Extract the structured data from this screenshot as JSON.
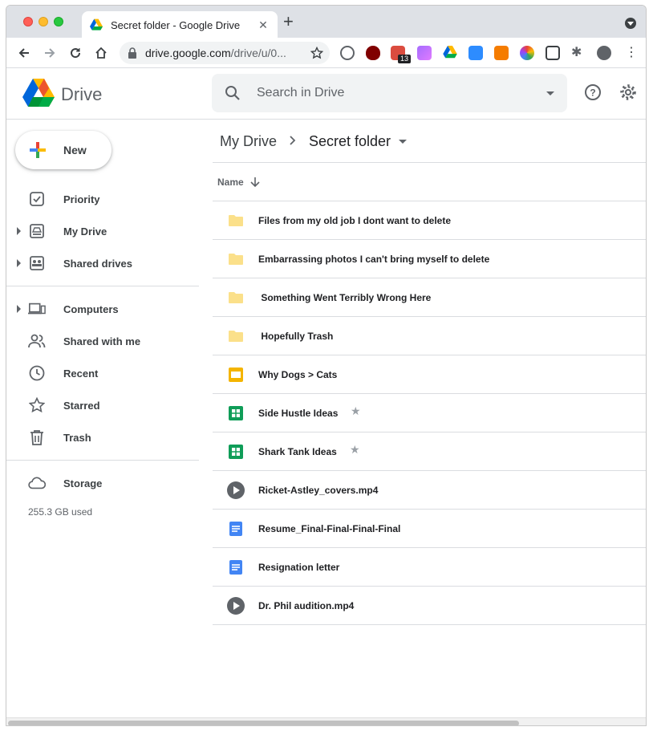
{
  "browser": {
    "tab_title": "Secret folder - Google Drive",
    "url_host": "drive.google.com",
    "url_path": "/drive/u/0...",
    "extension_badge": "13"
  },
  "header": {
    "app_name": "Drive",
    "search_placeholder": "Search in Drive"
  },
  "sidebar": {
    "new_label": "New",
    "items": [
      {
        "label": "Priority",
        "icon": "priority-icon"
      },
      {
        "label": "My Drive",
        "icon": "my-drive-icon"
      },
      {
        "label": "Shared drives",
        "icon": "shared-drives-icon"
      },
      {
        "label": "Computers",
        "icon": "computers-icon"
      },
      {
        "label": "Shared with me",
        "icon": "shared-with-me-icon"
      },
      {
        "label": "Recent",
        "icon": "recent-icon"
      },
      {
        "label": "Starred",
        "icon": "starred-icon"
      },
      {
        "label": "Trash",
        "icon": "trash-icon"
      },
      {
        "label": "Storage",
        "icon": "storage-icon"
      }
    ],
    "storage_used": "255.3 GB used"
  },
  "breadcrumb": {
    "parent": "My Drive",
    "current": "Secret folder"
  },
  "list": {
    "column_name": "Name",
    "files": [
      {
        "name": "Files from my old job I dont want to delete",
        "type": "folder",
        "starred": false
      },
      {
        "name": "Embarrassing photos I can't bring myself to delete",
        "type": "folder",
        "starred": false
      },
      {
        "name": " Something Went Terribly Wrong Here",
        "type": "folder",
        "starred": false
      },
      {
        "name": " Hopefully Trash",
        "type": "folder",
        "starred": false
      },
      {
        "name": "Why Dogs > Cats",
        "type": "slides",
        "starred": false
      },
      {
        "name": "Side Hustle Ideas",
        "type": "sheets",
        "starred": true
      },
      {
        "name": "Shark Tank Ideas",
        "type": "sheets",
        "starred": true
      },
      {
        "name": "Ricket-Astley_covers.mp4",
        "type": "video",
        "starred": false
      },
      {
        "name": "Resume_Final-Final-Final-Final",
        "type": "docs",
        "starred": false
      },
      {
        "name": "Resignation letter",
        "type": "docs",
        "starred": false
      },
      {
        "name": "Dr. Phil audition.mp4",
        "type": "video",
        "starred": false
      }
    ]
  },
  "colors": {
    "folder": "#fbe08a",
    "slides": "#f4b400",
    "sheets": "#0f9d58",
    "docs": "#4285f4",
    "video": "#5f6368"
  }
}
